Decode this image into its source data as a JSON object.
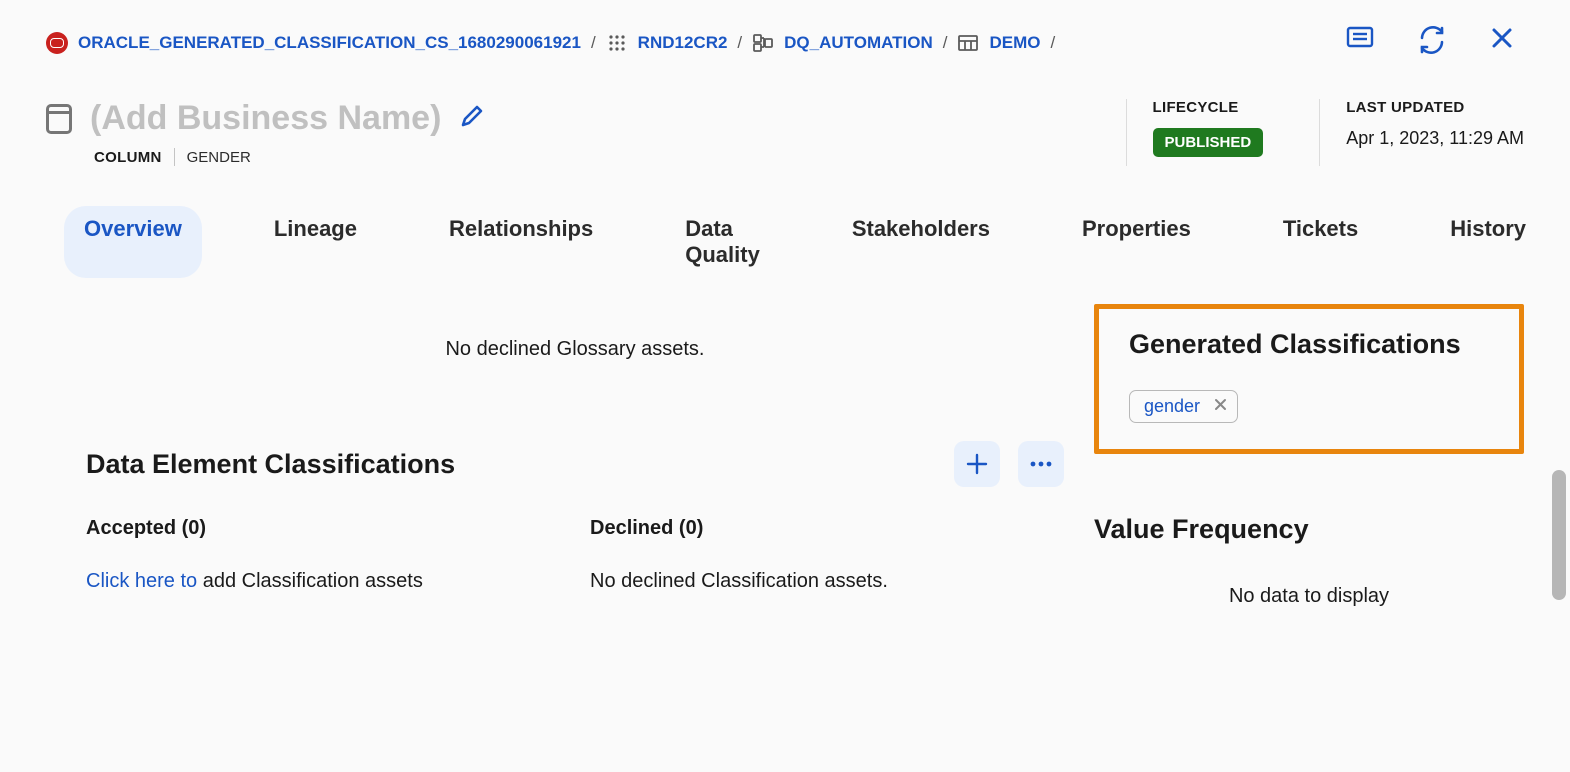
{
  "breadcrumb": [
    {
      "label": "ORACLE_GENERATED_CLASSIFICATION_CS_1680290061921"
    },
    {
      "label": "RND12CR2"
    },
    {
      "label": "DQ_AUTOMATION"
    },
    {
      "label": "DEMO"
    }
  ],
  "header": {
    "title_placeholder": "(Add Business Name)",
    "entity_type": "COLUMN",
    "entity_name": "GENDER",
    "lifecycle_label": "LIFECYCLE",
    "lifecycle_value": "PUBLISHED",
    "last_updated_label": "LAST UPDATED",
    "last_updated_value": "Apr 1, 2023, 11:29 AM"
  },
  "tabs": [
    "Overview",
    "Lineage",
    "Relationships",
    "Data Quality",
    "Stakeholders",
    "Properties",
    "Tickets",
    "History"
  ],
  "active_tab": 0,
  "overview": {
    "glossary_empty": "No declined Glossary assets.",
    "dec_title": "Data Element Classifications",
    "accepted_label": "Accepted (0)",
    "declined_label": "Declined (0)",
    "accepted_link": "Click here to",
    "accepted_tail": " add Classification assets",
    "declined_empty": "No declined Classification assets."
  },
  "generated": {
    "title": "Generated Classifications",
    "chip": "gender"
  },
  "value_freq": {
    "title": "Value Frequency",
    "empty": "No data to display"
  }
}
